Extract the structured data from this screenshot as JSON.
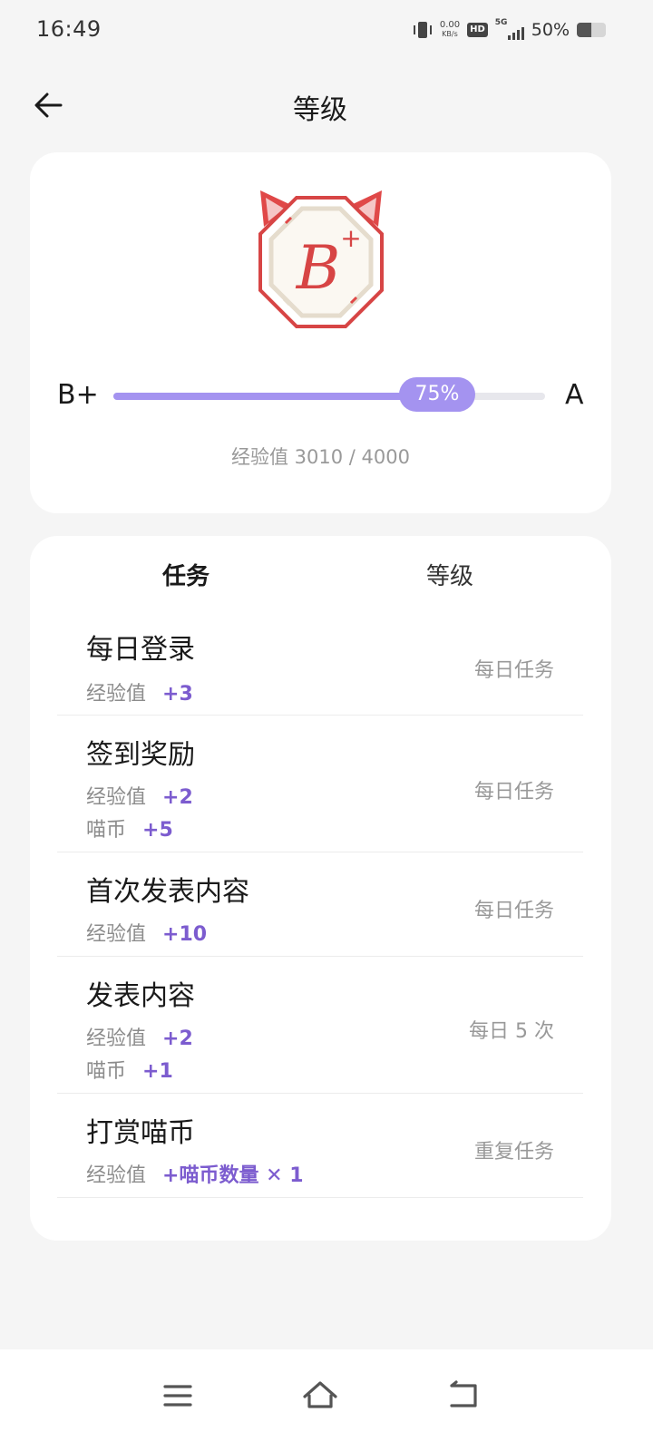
{
  "status_bar": {
    "time": "16:49",
    "net_speed_value": "0.00",
    "net_speed_unit": "KB/s",
    "hd_badge": "HD",
    "network_type": "5G",
    "battery_percent": "50%",
    "battery_level": 0.5,
    "icons": [
      "vibrate-icon",
      "signal-icon",
      "battery-icon"
    ]
  },
  "header": {
    "title": "等级",
    "back_icon": "arrow-left-icon"
  },
  "level_card": {
    "badge_icon": "cat-badge-icon",
    "badge_letter": "B",
    "badge_plus": "+",
    "current_level": "B+",
    "next_level": "A",
    "progress_label": "75%",
    "progress": 0.75,
    "exp_text": "经验值 3010 / 4000",
    "accent_color": "#a493f0"
  },
  "tabs": [
    {
      "label": "任务",
      "active": true
    },
    {
      "label": "等级",
      "active": false
    }
  ],
  "tasks": [
    {
      "title": "每日登录",
      "rewards": [
        {
          "label": "经验值",
          "value": "+3"
        }
      ],
      "frequency": "每日任务"
    },
    {
      "title": "签到奖励",
      "rewards": [
        {
          "label": "经验值",
          "value": "+2"
        },
        {
          "label": "喵币",
          "value": "+5"
        }
      ],
      "frequency": "每日任务"
    },
    {
      "title": "首次发表内容",
      "rewards": [
        {
          "label": "经验值",
          "value": "+10"
        }
      ],
      "frequency": "每日任务"
    },
    {
      "title": "发表内容",
      "rewards": [
        {
          "label": "经验值",
          "value": "+2"
        },
        {
          "label": "喵币",
          "value": "+1"
        }
      ],
      "frequency": "每日 5 次"
    },
    {
      "title": "打赏喵币",
      "rewards": [
        {
          "label": "经验值",
          "value": "+喵币数量 ✕ 1"
        }
      ],
      "frequency": "重复任务"
    }
  ],
  "nav_bar": {
    "icons": [
      "menu-icon",
      "home-icon",
      "back-icon"
    ]
  }
}
